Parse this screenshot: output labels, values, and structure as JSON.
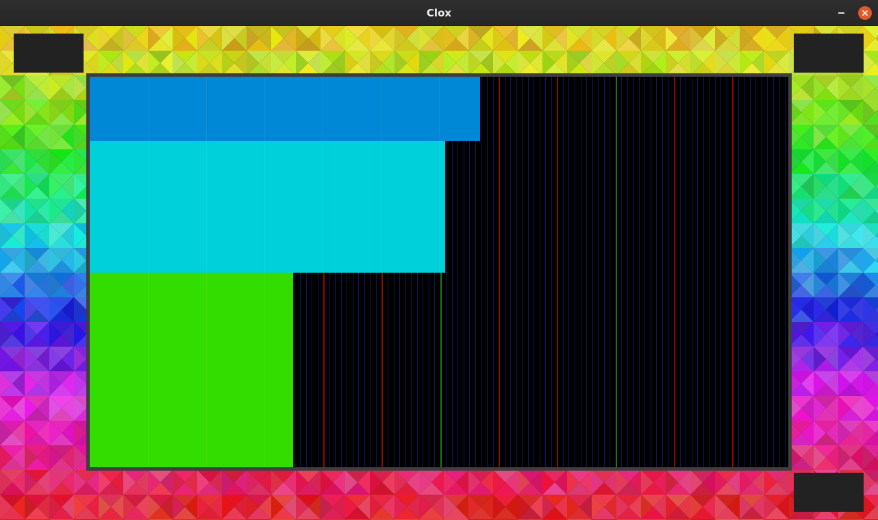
{
  "window": {
    "title": "Clox",
    "minimize_icon": "minimize-icon",
    "close_icon": "close-icon",
    "close_color": "#e05a2c"
  },
  "visualization": {
    "background_color": "#000000",
    "bars": [
      {
        "name": "blue",
        "fill_fraction": 0.559,
        "color": "#0088d6"
      },
      {
        "name": "cyan",
        "fill_fraction": 0.509,
        "color": "#00d0d9"
      },
      {
        "name": "green",
        "fill_fraction": 0.291,
        "color": "#33dd00"
      }
    ],
    "grid": {
      "minor_color": "#0c1a5a",
      "major_color": "#8b0a0a",
      "accent_color": "#1a7a1a"
    }
  },
  "theme": {
    "frame_color": "#3e3e3e",
    "corner_block_color": "#222222"
  }
}
